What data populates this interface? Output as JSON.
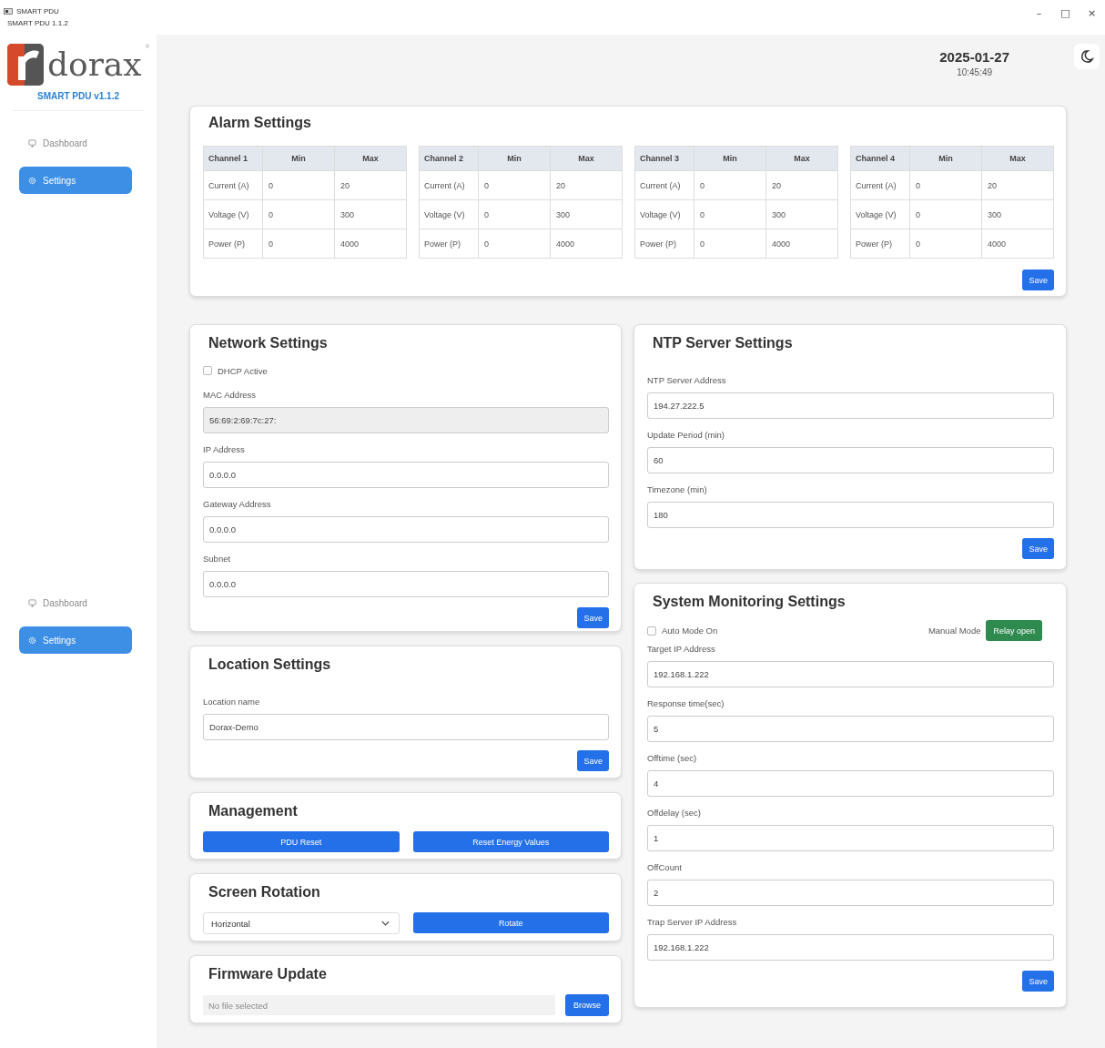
{
  "window": {
    "title": "SMART PDU",
    "subtitle": "SMART PDU 1.1.2",
    "controls": [
      "–",
      "□",
      "×"
    ]
  },
  "sidebar": {
    "brand": "dorax",
    "brand_mark": "®",
    "version": "SMART PDU v1.1.2",
    "nav_groups": [
      [
        {
          "label": "Dashboard",
          "kind": "monitor",
          "selected": false
        },
        {
          "label": "Settings",
          "kind": "gear",
          "selected": true
        }
      ],
      [
        {
          "label": "Dashboard",
          "kind": "monitor",
          "selected": false
        },
        {
          "label": "Settings",
          "kind": "gear",
          "selected": true
        }
      ]
    ]
  },
  "header": {
    "date": "2025-01-27",
    "time": "10:45:49"
  },
  "alarm_settings": {
    "title": "Alarm Settings",
    "save": "Save",
    "tables": [
      {
        "columns": [
          "Channel 1",
          "Min",
          "Max"
        ],
        "rows": [
          [
            "Current (A)",
            "0",
            "20"
          ],
          [
            "Voltage (V)",
            "0",
            "300"
          ],
          [
            "Power (P)",
            "0",
            "4000"
          ]
        ]
      },
      {
        "columns": [
          "Channel 2",
          "Min",
          "Max"
        ],
        "rows": [
          [
            "Current (A)",
            "0",
            "20"
          ],
          [
            "Voltage (V)",
            "0",
            "300"
          ],
          [
            "Power (P)",
            "0",
            "4000"
          ]
        ]
      },
      {
        "columns": [
          "Channel 3",
          "Min",
          "Max"
        ],
        "rows": [
          [
            "Current (A)",
            "0",
            "20"
          ],
          [
            "Voltage (V)",
            "0",
            "300"
          ],
          [
            "Power (P)",
            "0",
            "4000"
          ]
        ]
      },
      {
        "columns": [
          "Channel 4",
          "Min",
          "Max"
        ],
        "rows": [
          [
            "Current (A)",
            "0",
            "20"
          ],
          [
            "Voltage (V)",
            "0",
            "300"
          ],
          [
            "Power (P)",
            "0",
            "4000"
          ]
        ]
      }
    ]
  },
  "network_settings": {
    "title": "Network Settings",
    "save": "Save",
    "fields": [
      {
        "kind": "checkbox",
        "label": "DHCP Active",
        "checked": false
      },
      {
        "kind": "input",
        "label": "MAC Address",
        "value": "56:69:2:69:7c:27:",
        "disabled": true
      },
      {
        "kind": "input",
        "label": "IP Address",
        "value": "0.0.0.0",
        "disabled": false
      },
      {
        "kind": "input",
        "label": "Gateway Address",
        "value": "0.0.0.0",
        "disabled": false
      },
      {
        "kind": "input",
        "label": "Subnet",
        "value": "0.0.0.0",
        "disabled": false
      }
    ]
  },
  "location_settings": {
    "title": "Location Settings",
    "save": "Save",
    "fields": [
      {
        "kind": "input",
        "label": "Location name",
        "value": "Dorax-Demo",
        "disabled": false
      }
    ]
  },
  "management": {
    "title": "Management",
    "buttons": [
      "PDU Reset",
      "Reset Energy Values"
    ]
  },
  "screen_rotation": {
    "title": "Screen Rotation",
    "value": "Horizontal",
    "button": "Rotate"
  },
  "firmware_update": {
    "title": "Firmware Update",
    "placeholder": "No file selected",
    "button": "Browse"
  },
  "ntp_server_settings": {
    "title": "NTP Server Settings",
    "save": "Save",
    "fields": [
      {
        "kind": "input",
        "label": "NTP Server Address",
        "value": "194.27.222.5",
        "disabled": false
      },
      {
        "kind": "input",
        "label": "Update Period (min)",
        "value": "60",
        "disabled": false
      },
      {
        "kind": "input",
        "label": "Timezone (min)",
        "value": "180",
        "disabled": false
      }
    ]
  },
  "system_monitoring_settings": {
    "title": "System Monitoring Settings",
    "save": "Save",
    "auto_mode": {
      "label": "Auto Mode On",
      "checked": false
    },
    "mode_label": "Manual Mode",
    "relay_button": "Relay open",
    "fields": [
      {
        "kind": "input",
        "label": "Target IP Address",
        "value": "192.168.1.222",
        "disabled": false
      },
      {
        "kind": "input",
        "label": "Response time(sec)",
        "value": "5",
        "disabled": false
      },
      {
        "kind": "input",
        "label": "Offtime (sec)",
        "value": "4",
        "disabled": false
      },
      {
        "kind": "input",
        "label": "Offdelay (sec)",
        "value": "1",
        "disabled": false
      },
      {
        "kind": "input",
        "label": "OffCount",
        "value": "2",
        "disabled": false
      },
      {
        "kind": "input",
        "label": "Trap Server IP Address",
        "value": "192.168.1.222",
        "disabled": false
      }
    ]
  }
}
